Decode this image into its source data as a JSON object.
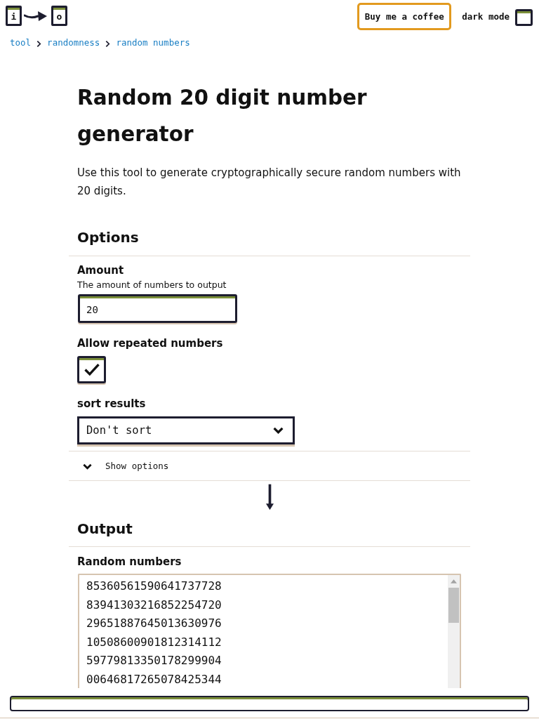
{
  "header": {
    "logo": {
      "left": "i",
      "right": "o"
    },
    "buy_button": "Buy me a coffee",
    "dark_mode": {
      "label": "dark mode",
      "checked": false
    }
  },
  "breadcrumbs": [
    "tool",
    "randomness",
    "random numbers"
  ],
  "title": "Random 20 digit number generator",
  "description": "Use this tool to generate cryptographically secure random numbers with 20 digits.",
  "options": {
    "heading": "Options",
    "fields": [
      {
        "kind": "number",
        "label": "Amount",
        "hint": "The amount of numbers to output",
        "value": "20"
      },
      {
        "kind": "checkbox",
        "label": "Allow repeated numbers",
        "checked": true
      },
      {
        "kind": "select",
        "label": "sort results",
        "value": "Don't sort"
      }
    ],
    "toggle": {
      "label": "Show options",
      "expanded": false
    }
  },
  "output": {
    "heading": "Output",
    "label": "Random numbers",
    "lines": [
      "85360561590641737728",
      "83941303216852254720",
      "29651887645013630976",
      "10508600901812314112",
      "59779813350178299904",
      "00646817265078425344"
    ]
  }
}
